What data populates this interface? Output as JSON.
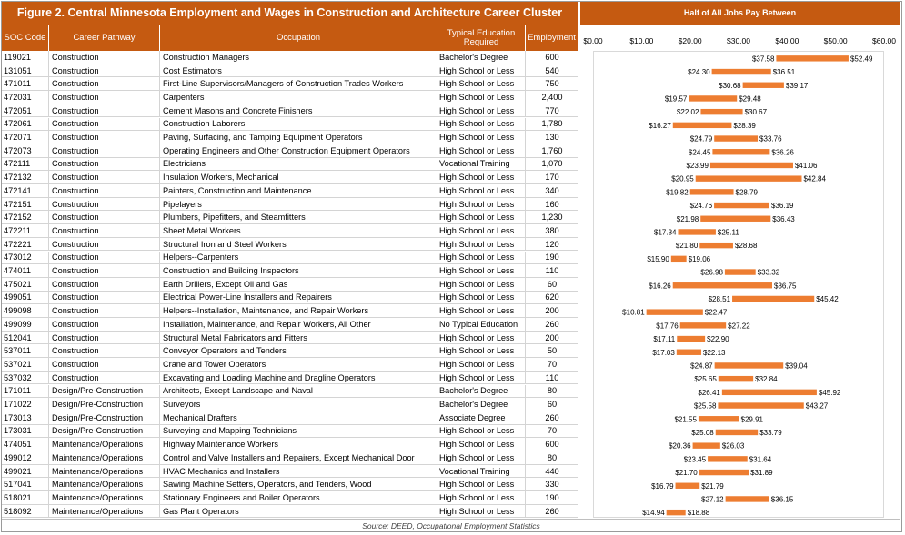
{
  "title": "Figure 2. Central Minnesota Employment and Wages in Construction and Architecture Career Cluster",
  "columns": {
    "soc": "SOC Code",
    "pathway": "Career Pathway",
    "occupation": "Occupation",
    "education": "Typical Education Required",
    "employment": "Employment"
  },
  "source": "Source: DEED, Occupational Employment Statistics",
  "colors": {
    "header": "#c55a11",
    "bar": "#ed7d31"
  },
  "chart_data": {
    "type": "bar",
    "orientation": "horizontal-range",
    "title": "Half of All Jobs Pay Between",
    "xlim": [
      0,
      60
    ],
    "xticks": [
      "$0.00",
      "$10.00",
      "$20.00",
      "$30.00",
      "$40.00",
      "$50.00",
      "$60.00"
    ],
    "xtick_values": [
      0,
      10,
      20,
      30,
      40,
      50,
      60
    ],
    "grid": false,
    "rows": [
      {
        "soc": "119021",
        "pathway": "Construction",
        "occupation": "Construction Managers",
        "education": "Bachelor's Degree",
        "employment": "600",
        "low": 37.58,
        "high": 52.49,
        "low_label": "$37.58",
        "high_label": "$52.49"
      },
      {
        "soc": "131051",
        "pathway": "Construction",
        "occupation": "Cost Estimators",
        "education": "High School or Less",
        "employment": "540",
        "low": 24.3,
        "high": 36.51,
        "low_label": "$24.30",
        "high_label": "$36.51"
      },
      {
        "soc": "471011",
        "pathway": "Construction",
        "occupation": "First-Line Supervisors/Managers of Construction Trades Workers",
        "education": "High School or Less",
        "employment": "750",
        "low": 30.68,
        "high": 39.17,
        "low_label": "$30.68",
        "high_label": "$39.17"
      },
      {
        "soc": "472031",
        "pathway": "Construction",
        "occupation": "Carpenters",
        "education": "High School or Less",
        "employment": "2,400",
        "low": 19.57,
        "high": 29.48,
        "low_label": "$19.57",
        "high_label": "$29.48"
      },
      {
        "soc": "472051",
        "pathway": "Construction",
        "occupation": "Cement Masons and Concrete Finishers",
        "education": "High School or Less",
        "employment": "770",
        "low": 22.02,
        "high": 30.67,
        "low_label": "$22.02",
        "high_label": "$30.67"
      },
      {
        "soc": "472061",
        "pathway": "Construction",
        "occupation": "Construction Laborers",
        "education": "High School or Less",
        "employment": "1,780",
        "low": 16.27,
        "high": 28.39,
        "low_label": "$16.27",
        "high_label": "$28.39"
      },
      {
        "soc": "472071",
        "pathway": "Construction",
        "occupation": "Paving, Surfacing, and Tamping Equipment Operators",
        "education": "High School or Less",
        "employment": "130",
        "low": 24.79,
        "high": 33.76,
        "low_label": "$24.79",
        "high_label": "$33.76"
      },
      {
        "soc": "472073",
        "pathway": "Construction",
        "occupation": "Operating Engineers and Other Construction Equipment Operators",
        "education": "High School or Less",
        "employment": "1,760",
        "low": 24.45,
        "high": 36.26,
        "low_label": "$24.45",
        "high_label": "$36.26"
      },
      {
        "soc": "472111",
        "pathway": "Construction",
        "occupation": "Electricians",
        "education": "Vocational Training",
        "employment": "1,070",
        "low": 23.99,
        "high": 41.06,
        "low_label": "$23.99",
        "high_label": "$41.06"
      },
      {
        "soc": "472132",
        "pathway": "Construction",
        "occupation": "Insulation Workers, Mechanical",
        "education": "High School or Less",
        "employment": "170",
        "low": 20.95,
        "high": 42.84,
        "low_label": "$20.95",
        "high_label": "$42.84"
      },
      {
        "soc": "472141",
        "pathway": "Construction",
        "occupation": "Painters, Construction and Maintenance",
        "education": "High School or Less",
        "employment": "340",
        "low": 19.82,
        "high": 28.79,
        "low_label": "$19.82",
        "high_label": "$28.79"
      },
      {
        "soc": "472151",
        "pathway": "Construction",
        "occupation": "Pipelayers",
        "education": "High School or Less",
        "employment": "160",
        "low": 24.76,
        "high": 36.19,
        "low_label": "$24.76",
        "high_label": "$36.19"
      },
      {
        "soc": "472152",
        "pathway": "Construction",
        "occupation": "Plumbers, Pipefitters, and Steamfitters",
        "education": "High School or Less",
        "employment": "1,230",
        "low": 21.98,
        "high": 36.43,
        "low_label": "$21.98",
        "high_label": "$36.43"
      },
      {
        "soc": "472211",
        "pathway": "Construction",
        "occupation": "Sheet Metal Workers",
        "education": "High School or Less",
        "employment": "380",
        "low": 17.34,
        "high": 25.11,
        "low_label": "$17.34",
        "high_label": "$25.11"
      },
      {
        "soc": "472221",
        "pathway": "Construction",
        "occupation": "Structural Iron and Steel Workers",
        "education": "High School or Less",
        "employment": "120",
        "low": 21.8,
        "high": 28.68,
        "low_label": "$21.80",
        "high_label": "$28.68"
      },
      {
        "soc": "473012",
        "pathway": "Construction",
        "occupation": "Helpers--Carpenters",
        "education": "High School or Less",
        "employment": "190",
        "low": 15.9,
        "high": 19.06,
        "low_label": "$15.90",
        "high_label": "$19.06"
      },
      {
        "soc": "474011",
        "pathway": "Construction",
        "occupation": "Construction and Building Inspectors",
        "education": "High School or Less",
        "employment": "110",
        "low": 26.98,
        "high": 33.32,
        "low_label": "$26.98",
        "high_label": "$33.32"
      },
      {
        "soc": "475021",
        "pathway": "Construction",
        "occupation": "Earth Drillers, Except Oil and Gas",
        "education": "High School or Less",
        "employment": "60",
        "low": 16.26,
        "high": 36.75,
        "low_label": "$16.26",
        "high_label": "$36.75"
      },
      {
        "soc": "499051",
        "pathway": "Construction",
        "occupation": "Electrical Power-Line Installers and Repairers",
        "education": "High School or Less",
        "employment": "620",
        "low": 28.51,
        "high": 45.42,
        "low_label": "$28.51",
        "high_label": "$45.42"
      },
      {
        "soc": "499098",
        "pathway": "Construction",
        "occupation": "Helpers--Installation, Maintenance, and Repair Workers",
        "education": "High School or Less",
        "employment": "200",
        "low": 10.81,
        "high": 22.47,
        "low_label": "$10.81",
        "high_label": "$22.47"
      },
      {
        "soc": "499099",
        "pathway": "Construction",
        "occupation": "Installation, Maintenance, and Repair Workers, All Other",
        "education": "No Typical Education",
        "employment": "260",
        "low": 17.76,
        "high": 27.22,
        "low_label": "$17.76",
        "high_label": "$27.22"
      },
      {
        "soc": "512041",
        "pathway": "Construction",
        "occupation": "Structural Metal Fabricators and Fitters",
        "education": "High School or Less",
        "employment": "200",
        "low": 17.11,
        "high": 22.9,
        "low_label": "$17.11",
        "high_label": "$22.90"
      },
      {
        "soc": "537011",
        "pathway": "Construction",
        "occupation": "Conveyor Operators and Tenders",
        "education": "High School or Less",
        "employment": "50",
        "low": 17.03,
        "high": 22.13,
        "low_label": "$17.03",
        "high_label": "$22.13"
      },
      {
        "soc": "537021",
        "pathway": "Construction",
        "occupation": "Crane and Tower Operators",
        "education": "High School or Less",
        "employment": "70",
        "low": 24.87,
        "high": 39.04,
        "low_label": "$24.87",
        "high_label": "$39.04"
      },
      {
        "soc": "537032",
        "pathway": "Construction",
        "occupation": "Excavating and Loading Machine and Dragline Operators",
        "education": "High School or Less",
        "employment": "110",
        "low": 25.65,
        "high": 32.84,
        "low_label": "$25.65",
        "high_label": "$32.84"
      },
      {
        "soc": "171011",
        "pathway": "Design/Pre-Construction",
        "occupation": "Architects, Except Landscape and Naval",
        "education": "Bachelor's Degree",
        "employment": "80",
        "low": 26.41,
        "high": 45.92,
        "low_label": "$26.41",
        "high_label": "$45.92"
      },
      {
        "soc": "171022",
        "pathway": "Design/Pre-Construction",
        "occupation": "Surveyors",
        "education": "Bachelor's Degree",
        "employment": "60",
        "low": 25.58,
        "high": 43.27,
        "low_label": "$25.58",
        "high_label": "$43.27"
      },
      {
        "soc": "173013",
        "pathway": "Design/Pre-Construction",
        "occupation": "Mechanical Drafters",
        "education": "Associate Degree",
        "employment": "260",
        "low": 21.55,
        "high": 29.91,
        "low_label": "$21.55",
        "high_label": "$29.91"
      },
      {
        "soc": "173031",
        "pathway": "Design/Pre-Construction",
        "occupation": "Surveying and Mapping Technicians",
        "education": "High School or Less",
        "employment": "70",
        "low": 25.08,
        "high": 33.79,
        "low_label": "$25.08",
        "high_label": "$33.79"
      },
      {
        "soc": "474051",
        "pathway": "Maintenance/Operations",
        "occupation": "Highway Maintenance Workers",
        "education": "High School or Less",
        "employment": "600",
        "low": 20.36,
        "high": 26.03,
        "low_label": "$20.36",
        "high_label": "$26.03"
      },
      {
        "soc": "499012",
        "pathway": "Maintenance/Operations",
        "occupation": "Control and Valve Installers and Repairers, Except Mechanical Door",
        "education": "High School or Less",
        "employment": "80",
        "low": 23.45,
        "high": 31.64,
        "low_label": "$23.45",
        "high_label": "$31.64"
      },
      {
        "soc": "499021",
        "pathway": "Maintenance/Operations",
        "occupation": "HVAC Mechanics and Installers",
        "education": "Vocational Training",
        "employment": "440",
        "low": 21.7,
        "high": 31.89,
        "low_label": "$21.70",
        "high_label": "$31.89"
      },
      {
        "soc": "517041",
        "pathway": "Maintenance/Operations",
        "occupation": "Sawing Machine Setters, Operators, and Tenders, Wood",
        "education": "High School or Less",
        "employment": "330",
        "low": 16.79,
        "high": 21.79,
        "low_label": "$16.79",
        "high_label": "$21.79"
      },
      {
        "soc": "518021",
        "pathway": "Maintenance/Operations",
        "occupation": "Stationary Engineers and Boiler Operators",
        "education": "High School or Less",
        "employment": "190",
        "low": 27.12,
        "high": 36.15,
        "low_label": "$27.12",
        "high_label": "$36.15"
      },
      {
        "soc": "518092",
        "pathway": "Maintenance/Operations",
        "occupation": "Gas Plant Operators",
        "education": "High School or Less",
        "employment": "260",
        "low": 14.94,
        "high": 18.88,
        "low_label": "$14.94",
        "high_label": "$18.88"
      }
    ]
  }
}
